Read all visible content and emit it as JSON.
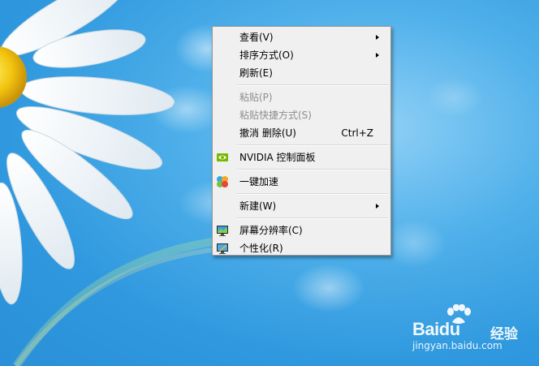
{
  "context_menu": {
    "items": {
      "view": {
        "label": "查看(V)",
        "icon": null,
        "submenu": true
      },
      "sort_by": {
        "label": "排序方式(O)",
        "submenu": true
      },
      "refresh": {
        "label": "刷新(E)"
      },
      "paste": {
        "label": "粘贴(P)",
        "disabled": true
      },
      "paste_shortcut": {
        "label": "粘贴快捷方式(S)",
        "disabled": true
      },
      "undo_delete": {
        "label": "撤消 删除(U)",
        "shortcut": "Ctrl+Z"
      },
      "nvidia_panel": {
        "label": "NVIDIA 控制面板",
        "icon": "nvidia-icon"
      },
      "one_key_speedup": {
        "label": "一键加速",
        "icon": "speedup-ball-icon"
      },
      "new": {
        "label": "新建(W)",
        "submenu": true
      },
      "screen_resolution": {
        "label": "屏幕分辨率(C)",
        "icon": "monitor-icon"
      },
      "personalize": {
        "label": "个性化(R)",
        "icon": "personalize-monitor-icon"
      }
    }
  },
  "watermark": {
    "brand_bai": "Bai",
    "brand_du": "du",
    "sub": "经验",
    "url": "jingyan.baidu.com"
  },
  "colors": {
    "menu_bg": "#f0f0f0",
    "menu_border": "#979797",
    "disabled_text": "#8d8d8d",
    "sky": "#2f98de"
  }
}
